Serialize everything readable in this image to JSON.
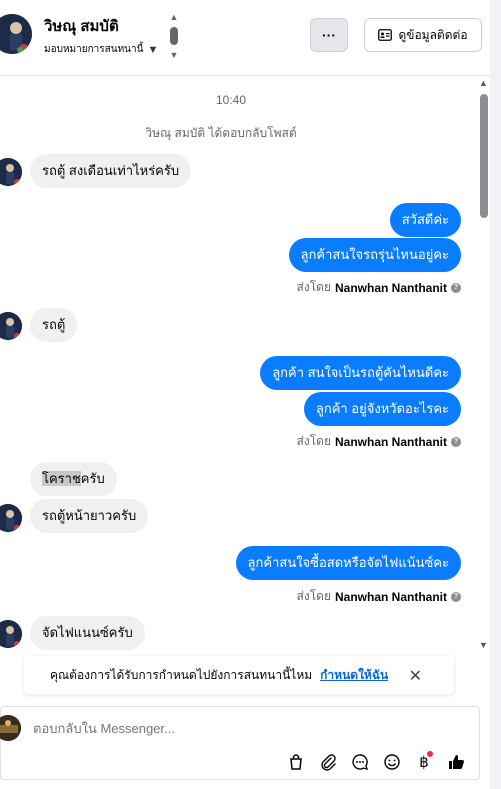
{
  "header": {
    "contact_name": "วิษณุ สมบัติ",
    "assign_label": "มอบหมายการสนทนานี้",
    "more_label": "···",
    "contact_info_label": "ดูข้อมูลติดต่อ"
  },
  "thread": {
    "timestamp": "10:40",
    "system_note": "วิษณุ สมบัติ ได้ตอบกลับโพสต์",
    "messages": [
      {
        "dir": "in",
        "text": "รถตู้ สงเดือนเท่าไหร่ครับ"
      },
      {
        "dir": "out",
        "text": "สวัสดีค่ะ"
      },
      {
        "dir": "out",
        "text": "ลูกค้าสนใจรถรุ่นไหนอยู่คะ"
      },
      {
        "dir": "sent_by",
        "prefix": "ส่งโดย",
        "name": "Nanwhan Nanthanit"
      },
      {
        "dir": "in",
        "text": "รถตู้"
      },
      {
        "dir": "out",
        "text": "ลูกค้า สนใจเป็นรถตู้คันไหนดีคะ"
      },
      {
        "dir": "out",
        "text": "ลูกค้า อยู่จังหวัดอะไรคะ"
      },
      {
        "dir": "sent_by",
        "prefix": "ส่งโดย",
        "name": "Nanwhan Nanthanit"
      },
      {
        "dir": "in",
        "text_highlight": "โคราช",
        "text_rest": "ครับ"
      },
      {
        "dir": "in",
        "text": "รถตู้หน้ายาวครับ"
      },
      {
        "dir": "out",
        "text": "ลูกค้าสนใจซื้อสดหรือจัดไฟแน้นซ์คะ"
      },
      {
        "dir": "sent_by",
        "prefix": "ส่งโดย",
        "name": "Nanwhan Nanthanit"
      },
      {
        "dir": "in",
        "text": "จัดไฟแนนซ์ครับ"
      }
    ]
  },
  "notice": {
    "text": "คุณต้องการได้รับการกำหนดไปยังการสนทนานี้ไหม",
    "link": "กำหนดให้ฉัน"
  },
  "composer": {
    "placeholder": "ตอบกลับใน Messenger...",
    "tools": [
      "shopping-bag-icon",
      "paperclip-icon",
      "saved-reply-icon",
      "emoji-icon",
      "baht-icon",
      "thumbs-up-icon"
    ]
  },
  "colors": {
    "outgoing_bubble": "#0a7cff",
    "incoming_bubble": "#f0f0f0",
    "link": "#0a66d6"
  }
}
